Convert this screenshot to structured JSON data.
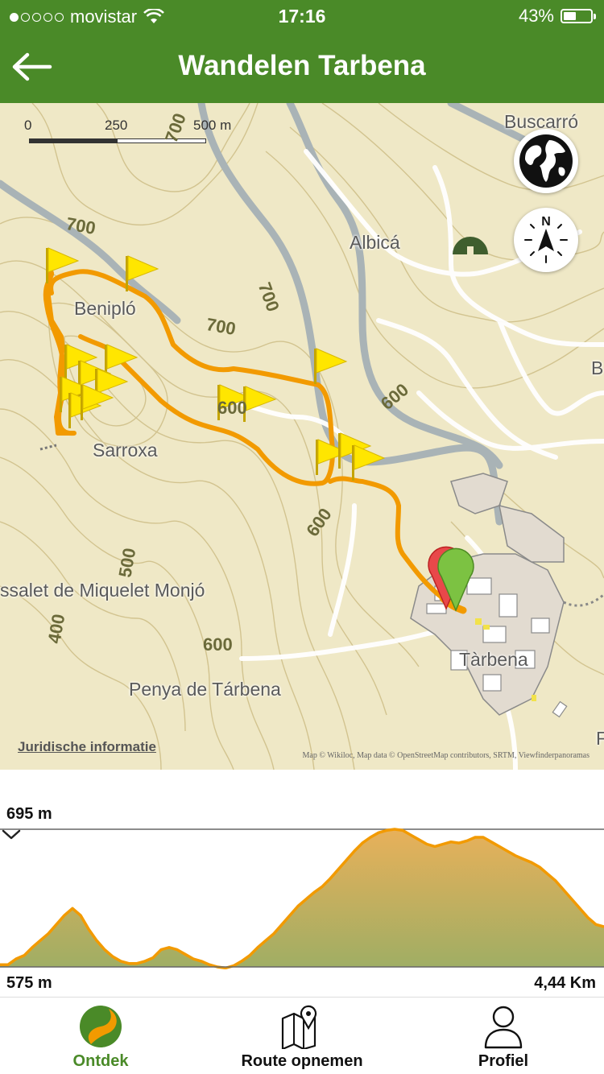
{
  "status_bar": {
    "carrier": "movistar",
    "time": "17:16",
    "battery": "43%",
    "battery_level": 0.43,
    "signal_dots_filled": 1,
    "signal_dots_total": 5
  },
  "nav": {
    "title": "Wandelen Tarbena",
    "back_icon": "arrow-left-icon"
  },
  "map": {
    "scale": {
      "zero": "0",
      "mid": "250",
      "end": "500 m"
    },
    "place_labels": [
      "Buscarró",
      "Albicá",
      "Benipló",
      "Sarroxa",
      "ssalet de Miquelet Monjó",
      "Tàrbena",
      "Penya de Tárbena",
      "B",
      "F"
    ],
    "contour_labels": [
      "700",
      "700",
      "700",
      "700",
      "600",
      "600",
      "600",
      "600",
      "500",
      "400"
    ],
    "legal_link": "Juridische informatie",
    "attribution": "Map © Wikiloc, Map data © OpenStreetMap contributors, SRTM, Viewfinderpanoramas",
    "layers_button_icon": "globe-icon",
    "compass_button_icon": "compass-icon",
    "route_color": "#f29a00",
    "waypoint_icon": "flag-icon",
    "start_marker_color": "#e8484a",
    "end_marker_color": "#7cc242"
  },
  "elevation": {
    "max_label": "695 m",
    "min_label": "575 m",
    "distance_label": "4,44 Km",
    "collapse_icon": "chevron-down-icon",
    "profile_m": [
      577,
      577,
      582,
      585,
      592,
      598,
      604,
      612,
      620,
      626,
      620,
      608,
      598,
      590,
      584,
      580,
      578,
      578,
      580,
      583,
      590,
      592,
      590,
      586,
      582,
      580,
      577,
      575,
      574,
      576,
      580,
      585,
      592,
      598,
      604,
      612,
      620,
      628,
      634,
      640,
      645,
      652,
      660,
      668,
      676,
      683,
      688,
      692,
      694,
      695,
      694,
      690,
      686,
      682,
      680,
      682,
      684,
      683,
      685,
      688,
      688,
      684,
      680,
      676,
      672,
      669,
      666,
      662,
      656,
      650,
      642,
      634,
      626,
      618,
      612,
      610
    ]
  },
  "tabs": [
    {
      "label": "Ontdek",
      "icon": "discover-icon",
      "active": true
    },
    {
      "label": "Route opnemen",
      "icon": "map-pin-icon",
      "active": false
    },
    {
      "label": "Profiel",
      "icon": "profile-icon",
      "active": false
    }
  ],
  "colors": {
    "brand_green": "#4a8a28",
    "map_background": "#efe8c6",
    "elevation_fill_top": "#e8b05a",
    "elevation_fill_bottom": "#9fae64"
  }
}
